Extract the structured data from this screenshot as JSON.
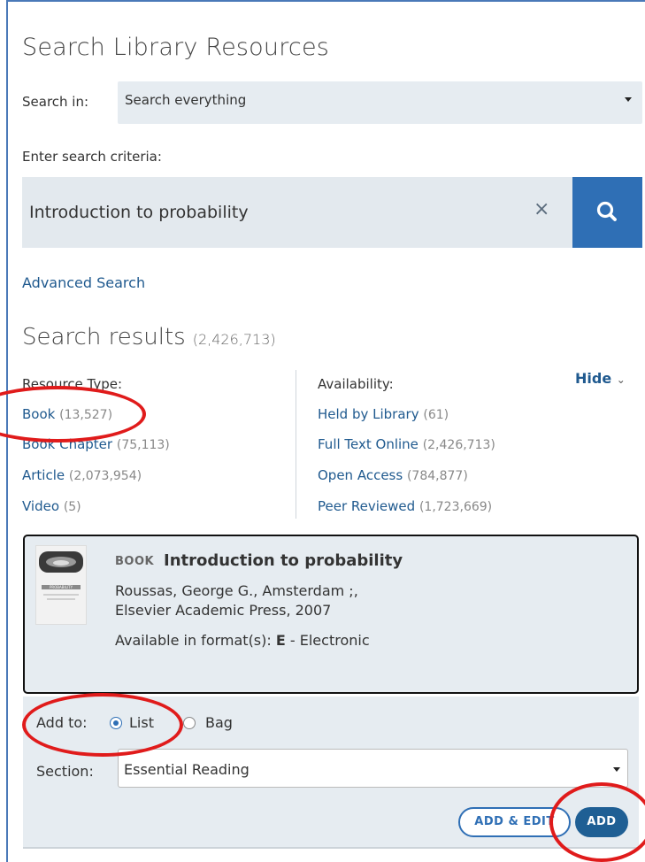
{
  "page": {
    "title": "Search Library Resources",
    "search_in_label": "Search in:",
    "search_in_value": "Search everything",
    "criteria_label": "Enter search criteria:",
    "query": "Introduction to probability",
    "clear_icon": "×",
    "advanced_search": "Advanced Search"
  },
  "results": {
    "heading": "Search results",
    "count": "(2,426,713)",
    "hide_label": "Hide",
    "resource_type": {
      "heading": "Resource Type:",
      "items": [
        {
          "label": "Book",
          "count": "(13,527)"
        },
        {
          "label": "Book Chapter",
          "count": "(75,113)"
        },
        {
          "label": "Article",
          "count": "(2,073,954)"
        },
        {
          "label": "Video",
          "count": "(5)"
        }
      ]
    },
    "availability": {
      "heading": "Availability:",
      "items": [
        {
          "label": "Held by Library",
          "count": "(61)"
        },
        {
          "label": "Full Text Online",
          "count": "(2,426,713)"
        },
        {
          "label": "Open Access",
          "count": "(784,877)"
        },
        {
          "label": "Peer Reviewed",
          "count": "(1,723,669)"
        }
      ]
    }
  },
  "result_card": {
    "type_badge": "BOOK",
    "title": "Introduction to probability",
    "line1": "Roussas, George G., Amsterdam ;,",
    "line2": "Elsevier Academic Press, 2007",
    "format_prefix": "Available in format(s): ",
    "format_code": "E",
    "format_suffix": " - Electronic",
    "thumb_text": "PROBABILITY"
  },
  "add_panel": {
    "add_to_label": "Add to:",
    "option_list": "List",
    "option_bag": "Bag",
    "selected": "List",
    "section_label": "Section:",
    "section_value": "Essential Reading",
    "add_edit_button": "ADD & EDIT",
    "add_button": "ADD"
  },
  "icons": {
    "search": "search-icon",
    "clear": "close-icon",
    "caret": "caret-down-icon",
    "chevron": "chevron-down-icon"
  },
  "colors": {
    "accent": "#2f6fb5",
    "link": "#205a8f",
    "panel": "#e6ecf1",
    "annotation": "#e01b1b"
  }
}
